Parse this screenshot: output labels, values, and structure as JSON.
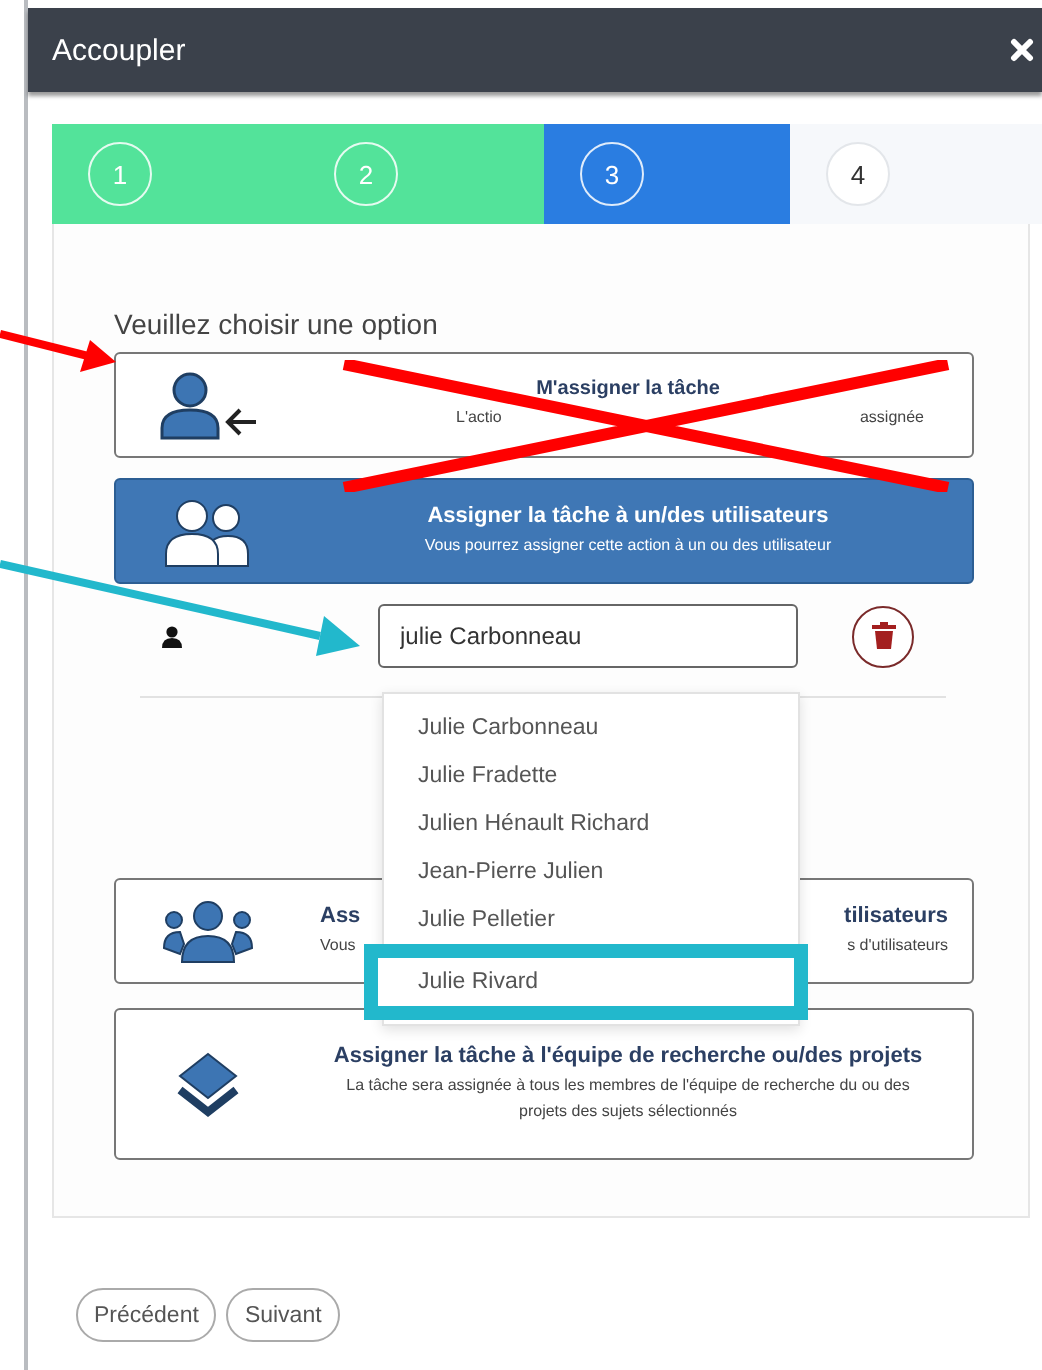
{
  "dialog": {
    "title": "Accoupler"
  },
  "steps": [
    {
      "label": "1",
      "completed": true,
      "selected": false
    },
    {
      "label": "2",
      "completed": true,
      "selected": false
    },
    {
      "label": "3",
      "completed": false,
      "selected": true
    },
    {
      "label": "4",
      "completed": false,
      "selected": false
    }
  ],
  "heading": {
    "text": "Veuillez choisir une option"
  },
  "options": [
    {
      "title": "M'assigner la tâche",
      "subtitle_parts": [
        "L'actio",
        "assignée"
      ],
      "selected": false,
      "crossed_out": true
    },
    {
      "title": "Assigner la tâche à un/des utilisateurs",
      "subtitle": "Vous pourrez assigner cette action à un ou des utilisateur",
      "selected": true,
      "crossed_out": false
    },
    {
      "title_parts": [
        "Ass",
        "tilisateurs"
      ],
      "subtitle_parts": [
        "Vous",
        "s d'utilisateurs"
      ],
      "selected": false,
      "crossed_out": false
    },
    {
      "title": "Assigner la tâche à l'équipe de recherche ou/des projets",
      "subtitle": "La tâche sera assignée à tous les membres de l'équipe de recherche du ou des projets des sujets sélectionnés",
      "selected": false,
      "crossed_out": false
    }
  ],
  "user_field": {
    "value": "julie Carbonneau"
  },
  "suggestions": [
    {
      "label": "Julie Carbonneau",
      "highlighted": false
    },
    {
      "label": "Julie Fradette",
      "highlighted": false
    },
    {
      "label": "Julien Hénault Richard",
      "highlighted": false
    },
    {
      "label": "Jean-Pierre Julien",
      "highlighted": false
    },
    {
      "label": "Julie Pelletier",
      "highlighted": false
    },
    {
      "label": "Julie Rivard",
      "highlighted": true
    }
  ],
  "buttons": [
    "Précédent",
    "Suivant"
  ]
}
